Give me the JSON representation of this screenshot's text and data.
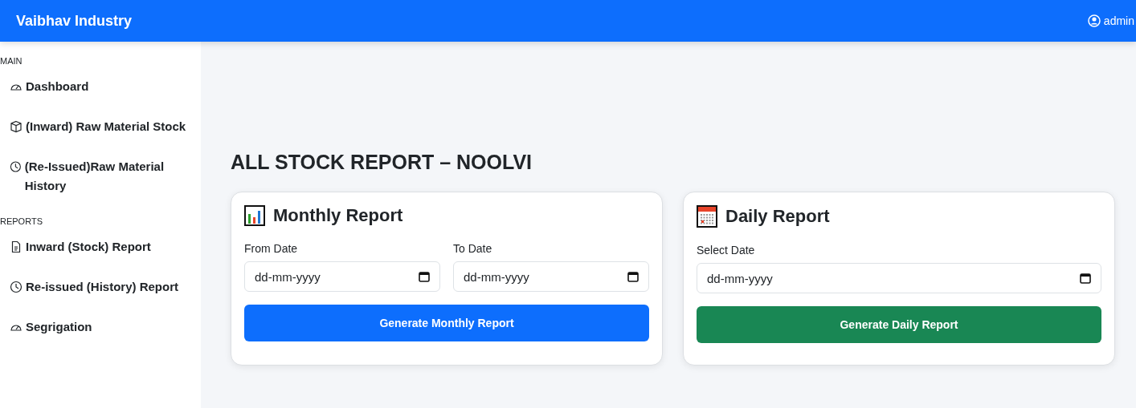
{
  "navbar": {
    "brand": "Vaibhav Industry",
    "user": "admin"
  },
  "sidebar": {
    "sections": [
      {
        "heading": "MAIN",
        "items": [
          {
            "label": "Dashboard"
          },
          {
            "label": "(Inward) Raw Material Stock"
          },
          {
            "label": "(Re-Issued)Raw Material History"
          }
        ]
      },
      {
        "heading": "REPORTS",
        "items": [
          {
            "label": "Inward (Stock) Report"
          },
          {
            "label": "Re-issued (History) Report"
          },
          {
            "label": "Segrigation"
          }
        ]
      }
    ]
  },
  "page_title": "ALL STOCK REPORT – NOOLVI",
  "cards": [
    {
      "title": "Monthly Report",
      "fields": [
        {
          "label": "From Date",
          "placeholder": "dd-mm-yyyy"
        },
        {
          "label": "To Date",
          "placeholder": "dd-mm-yyyy"
        }
      ],
      "button": {
        "label": "Generate Monthly Report",
        "color": "#0d6efd"
      }
    },
    {
      "title": "Daily Report",
      "fields": [
        {
          "label": "Select Date",
          "placeholder": "dd-mm-yyyy"
        }
      ],
      "button": {
        "label": "Generate Daily Report",
        "color": "#198754"
      }
    }
  ]
}
